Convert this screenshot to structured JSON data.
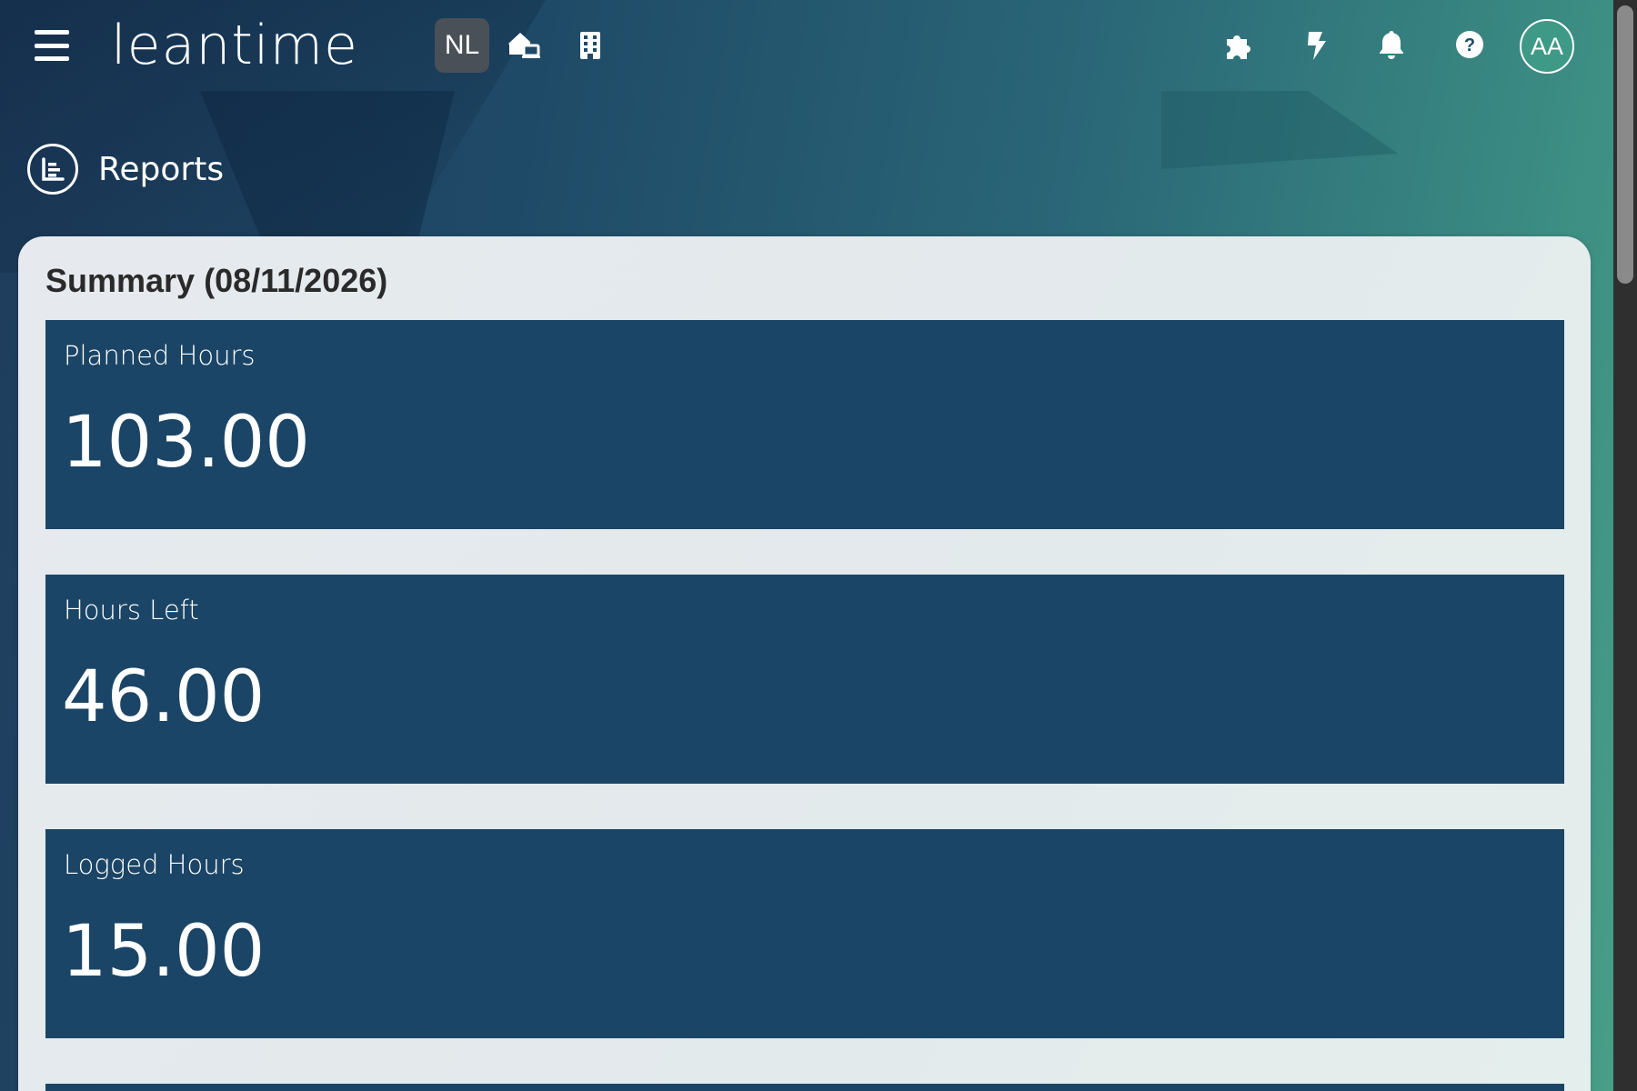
{
  "header": {
    "logo_text": "leantime",
    "menu_icon": "hamburger-menu-icon",
    "project_badge": "NL",
    "icons": [
      "home-switch-icon",
      "building-icon",
      "puzzle-icon",
      "lightning-icon",
      "bell-icon",
      "help-icon"
    ],
    "avatar_initials": "AA"
  },
  "page": {
    "title": "Reports",
    "title_icon": "report-icon"
  },
  "summary": {
    "title": "Summary (08/11/2026)",
    "stats": [
      {
        "label": "Planned Hours",
        "value": "103.00"
      },
      {
        "label": "Hours Left",
        "value": "46.00"
      },
      {
        "label": "Logged Hours",
        "value": "15.00"
      }
    ]
  },
  "colors": {
    "card_tile": "#1b4566",
    "avatar_bg": "#3e9a86",
    "badge_bg": "#4a5058"
  }
}
